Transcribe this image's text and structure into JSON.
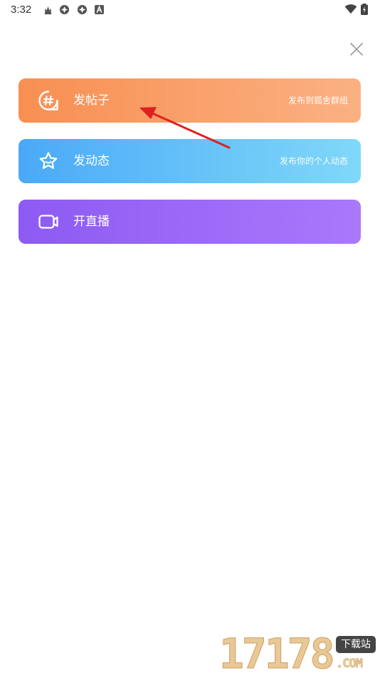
{
  "status_bar": {
    "time": "3:32",
    "icons": [
      "cat-icon",
      "settings-icon",
      "settings-icon",
      "app-a-icon",
      "wifi-icon",
      "battery-icon"
    ]
  },
  "close_icon": "close-icon",
  "actions": [
    {
      "label": "发帖子",
      "sub": "发布到狐舍群组",
      "icon": "hashtag-icon",
      "colors": [
        "#f88f52",
        "#fbb183"
      ]
    },
    {
      "label": "发动态",
      "sub": "发布你的个人动态",
      "icon": "star-icon",
      "colors": [
        "#4aa9f7",
        "#80d8f9"
      ]
    },
    {
      "label": "开直播",
      "sub": "",
      "icon": "video-camera-icon",
      "colors": [
        "#8d5af3",
        "#aa78fb"
      ]
    }
  ],
  "annotation": {
    "arrow_color": "#e02020"
  },
  "watermark": {
    "digits": "17178",
    "badge": "下载站",
    "domain": ".COM"
  }
}
